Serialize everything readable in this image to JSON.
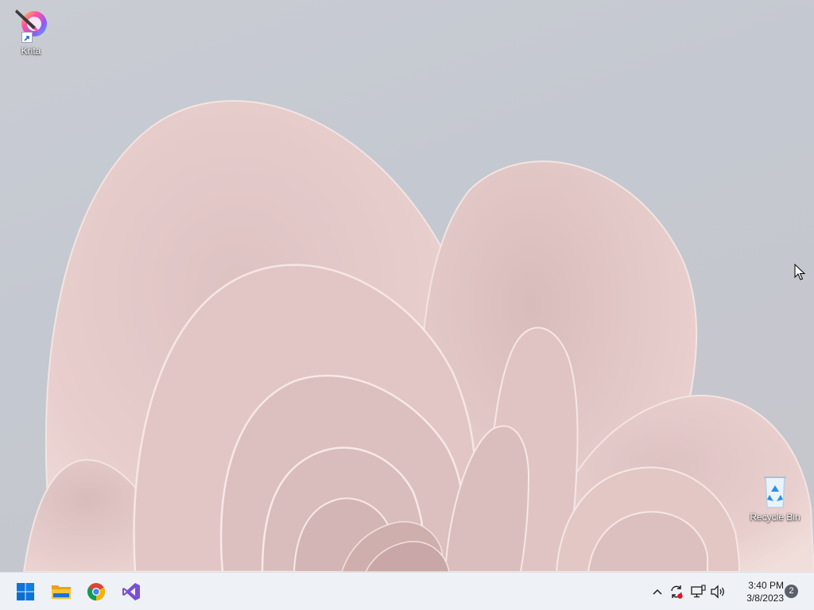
{
  "desktop": {
    "icons": [
      {
        "label": "Krita",
        "icon": "krita-icon"
      },
      {
        "label": "Recycle Bin",
        "icon": "recycle-bin-icon"
      }
    ]
  },
  "taskbar": {
    "pinned": [
      {
        "name": "Start",
        "icon": "windows-start-icon"
      },
      {
        "name": "File Explorer",
        "icon": "folder-icon"
      },
      {
        "name": "Google Chrome",
        "icon": "chrome-icon"
      },
      {
        "name": "Visual Studio",
        "icon": "visual-studio-icon"
      }
    ],
    "tray": {
      "icons": [
        "chevron-up-icon",
        "sync-icon",
        "network-icon",
        "volume-icon"
      ],
      "time": "3:40 PM",
      "date": "3/8/2023",
      "notification_count": "2"
    }
  },
  "colors": {
    "taskbar_bg": "#eef1f5",
    "wallpaper_petal": "#e6c9c7",
    "start_blue": "#0a74da"
  }
}
